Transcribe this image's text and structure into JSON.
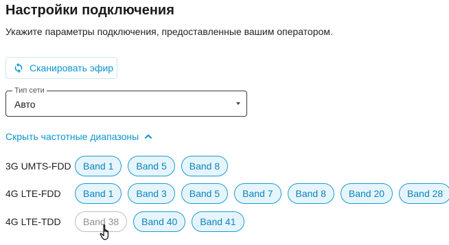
{
  "page": {
    "title": "Настройки подключения",
    "subtitle": "Укажите параметры подключения, предоставленные вашим оператором."
  },
  "scan_button": {
    "label": "Сканировать эфир",
    "icon": "refresh-icon"
  },
  "network_type": {
    "legend": "Тип сети",
    "value": "Авто",
    "icon": "dropdown-arrow-icon"
  },
  "bands_toggle": {
    "label": "Скрыть частотные диапазоны",
    "icon": "chevron-up-icon"
  },
  "colors": {
    "accent": "#0a95cf",
    "chip_active_bg": "#e6f5fc",
    "chip_active_border": "#1a9bd2",
    "chip_inactive_border": "#bdbdbd"
  },
  "band_groups": [
    {
      "label": "3G UMTS-FDD",
      "bands": [
        {
          "label": "Band 1",
          "selected": true
        },
        {
          "label": "Band 5",
          "selected": true
        },
        {
          "label": "Band 8",
          "selected": true
        }
      ]
    },
    {
      "label": "4G LTE-FDD",
      "bands": [
        {
          "label": "Band 1",
          "selected": true
        },
        {
          "label": "Band 3",
          "selected": true
        },
        {
          "label": "Band 5",
          "selected": true
        },
        {
          "label": "Band 7",
          "selected": true
        },
        {
          "label": "Band 8",
          "selected": true
        },
        {
          "label": "Band 20",
          "selected": true
        },
        {
          "label": "Band 28",
          "selected": true
        }
      ]
    },
    {
      "label": "4G LTE-TDD",
      "bands": [
        {
          "label": "Band 38",
          "selected": false
        },
        {
          "label": "Band 40",
          "selected": true
        },
        {
          "label": "Band 41",
          "selected": true
        }
      ]
    }
  ]
}
